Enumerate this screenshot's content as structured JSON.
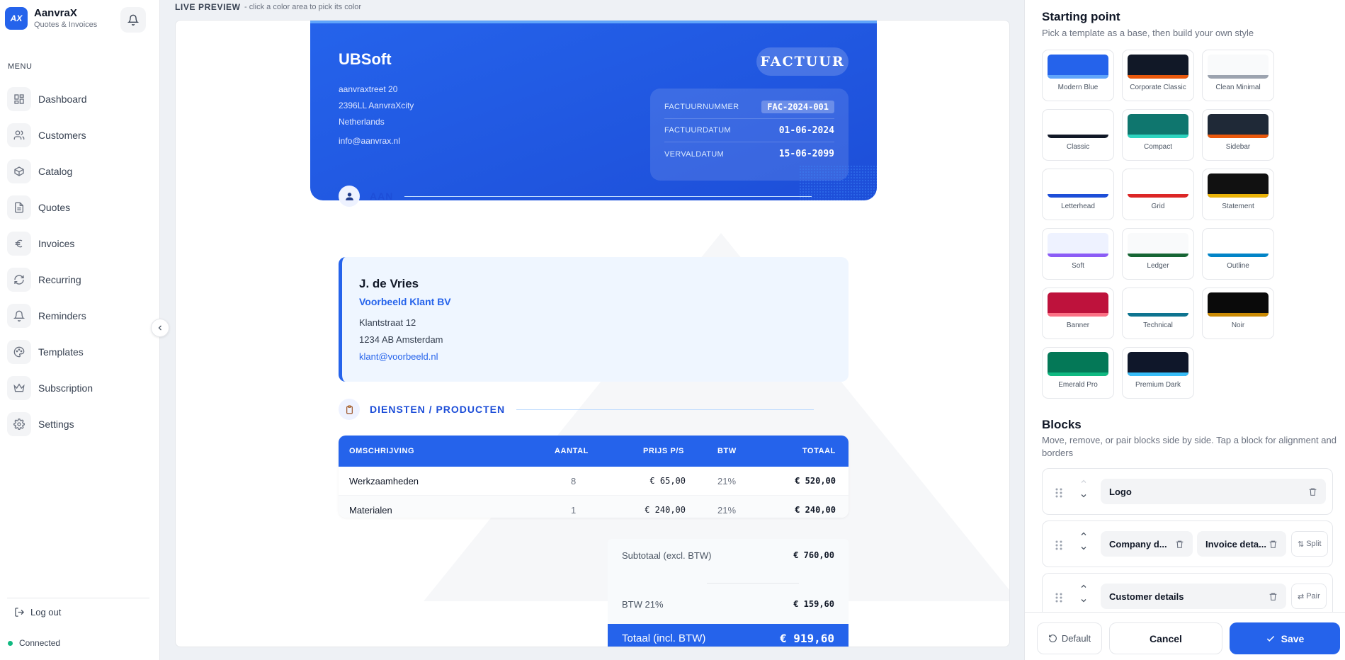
{
  "app": {
    "name": "AanvraX",
    "tagline": "Quotes & Invoices",
    "logo_text": "AX"
  },
  "sidebar": {
    "menu_title": "MENU",
    "items": [
      {
        "label": "Dashboard",
        "icon": "grid-icon"
      },
      {
        "label": "Customers",
        "icon": "users-icon"
      },
      {
        "label": "Catalog",
        "icon": "box-icon"
      },
      {
        "label": "Quotes",
        "icon": "document-icon"
      },
      {
        "label": "Invoices",
        "icon": "euro-icon"
      },
      {
        "label": "Recurring",
        "icon": "refresh-icon"
      },
      {
        "label": "Reminders",
        "icon": "bell-icon"
      },
      {
        "label": "Templates",
        "icon": "palette-icon"
      },
      {
        "label": "Subscription",
        "icon": "crown-icon"
      },
      {
        "label": "Settings",
        "icon": "gear-icon"
      }
    ],
    "logout": "Log out",
    "status": "Connected"
  },
  "preview": {
    "label": "LIVE PREVIEW",
    "hint": "- click a color area to pick its color"
  },
  "invoice": {
    "company": "UBSoft",
    "address": [
      "aanvraxtreet 20",
      "2396LL AanvraXcity",
      "Netherlands"
    ],
    "email": "info@aanvrax.nl",
    "doc_type": "FACTUUR",
    "meta": [
      {
        "key": "FACTUURNUMMER",
        "value": "FAC-2024-001"
      },
      {
        "key": "FACTUURDATUM",
        "value": "01-06-2024"
      },
      {
        "key": "VERVALDATUM",
        "value": "15-06-2099"
      }
    ],
    "to_title": "AAN",
    "customer": {
      "name": "J. de Vries",
      "company": "Voorbeeld Klant BV",
      "street": "Klantstraat 12",
      "city": "1234 AB Amsterdam",
      "email": "klant@voorbeeld.nl"
    },
    "items_title": "DIENSTEN / PRODUCTEN",
    "columns": {
      "desc": "OMSCHRIJVING",
      "qty": "AANTAL",
      "price": "PRIJS P/S",
      "vat": "BTW",
      "total": "TOTAAL"
    },
    "rows": [
      {
        "desc": "Werkzaamheden",
        "qty": "8",
        "price": "€ 65,00",
        "vat": "21%",
        "total": "€ 520,00"
      },
      {
        "desc": "Materialen",
        "qty": "1",
        "price": "€ 240,00",
        "vat": "21%",
        "total": "€ 240,00"
      }
    ],
    "subtotal_label": "Subtotaal (excl. BTW)",
    "subtotal": "€ 760,00",
    "vat_label": "BTW 21%",
    "vat": "€ 159,60",
    "grand_label": "Totaal (incl. BTW)",
    "grand": "€ 919,60"
  },
  "panel": {
    "start_title": "Starting point",
    "start_sub": "Pick a template as a base, then build your own style",
    "templates": [
      {
        "name": "Modern Blue",
        "top": "#2563eb",
        "bar": "#60a5fa"
      },
      {
        "name": "Corporate Classic",
        "top": "#111827",
        "bar": "#ea580c"
      },
      {
        "name": "Clean Minimal",
        "top": "#f9fafb",
        "bar": "#9ca3af"
      },
      {
        "name": "Classic",
        "top": "#ffffff",
        "bar": "#111827"
      },
      {
        "name": "Compact",
        "top": "#0f766e",
        "bar": "#2dd4bf"
      },
      {
        "name": "Sidebar",
        "top": "#1f2937",
        "bar": "#ea580c"
      },
      {
        "name": "Letterhead",
        "top": "#ffffff",
        "bar": "#1d4ed8"
      },
      {
        "name": "Grid",
        "top": "#ffffff",
        "bar": "#dc2626"
      },
      {
        "name": "Statement",
        "top": "#111111",
        "bar": "#eab308"
      },
      {
        "name": "Soft",
        "top": "#eef2ff",
        "bar": "#8b5cf6"
      },
      {
        "name": "Ledger",
        "top": "#f9fafb",
        "bar": "#166534"
      },
      {
        "name": "Outline",
        "top": "#ffffff",
        "bar": "#0284c7"
      },
      {
        "name": "Banner",
        "top": "#be123c",
        "bar": "#fb7185"
      },
      {
        "name": "Technical",
        "top": "#ffffff",
        "bar": "#0e7490"
      },
      {
        "name": "Noir",
        "top": "#0a0a0a",
        "bar": "#ca8a04"
      },
      {
        "name": "Emerald Pro",
        "top": "#047857",
        "bar": "#10b981"
      },
      {
        "name": "Premium Dark",
        "top": "#0f172a",
        "bar": "#38bdf8"
      }
    ],
    "blocks_title": "Blocks",
    "blocks_sub": "Move, remove, or pair blocks side by side. Tap a block for alignment and borders",
    "blocks": {
      "logo": "Logo",
      "company": "Company d...",
      "invoice": "Invoice deta...",
      "split": "Split",
      "customer": "Customer details",
      "pair": "Pair"
    },
    "buttons": {
      "default": "Default",
      "cancel": "Cancel",
      "save": "Save"
    }
  },
  "colors": {
    "accent": "#2563eb",
    "connected": "#10b981"
  }
}
